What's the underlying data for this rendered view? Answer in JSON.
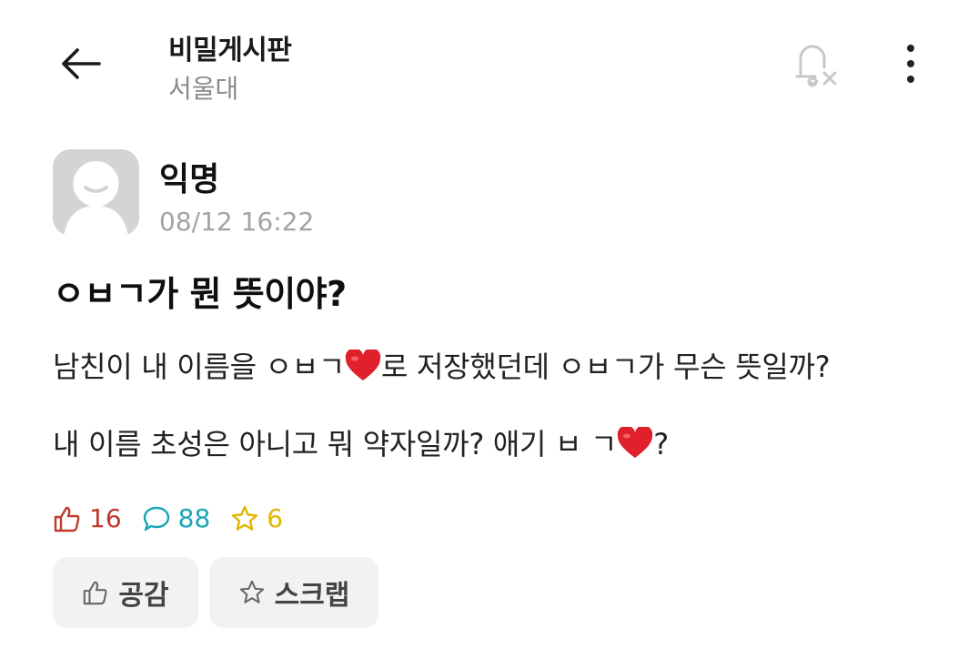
{
  "header": {
    "board_title": "비밀게시판",
    "school": "서울대"
  },
  "post": {
    "author": "익명",
    "time": "08/12 16:22",
    "title": "ㅇㅂㄱ가 뭔 뜻이야?",
    "body_line1_a": "남친이 내 이름을 ㅇㅂㄱ",
    "body_line1_b": "로 저장했던데 ㅇㅂㄱ가 무슨 뜻일까?",
    "body_line2_a": "내 이름 초성은 아니고 뭐 약자일까? 애기 ㅂ ㄱ",
    "body_line2_b": "?"
  },
  "stats": {
    "likes": "16",
    "comments": "88",
    "scraps": "6"
  },
  "actions": {
    "like_label": "공감",
    "scrap_label": "스크랩"
  },
  "colors": {
    "like": "#c0392b",
    "comment": "#1aa5b8",
    "scrap": "#e0b600",
    "heart": "#e0202a"
  },
  "icons": [
    "back-arrow-icon",
    "bell-off-icon",
    "more-vertical-icon",
    "anonymous-avatar",
    "heart-emoji",
    "thumbs-up-icon",
    "comment-icon",
    "star-icon"
  ]
}
